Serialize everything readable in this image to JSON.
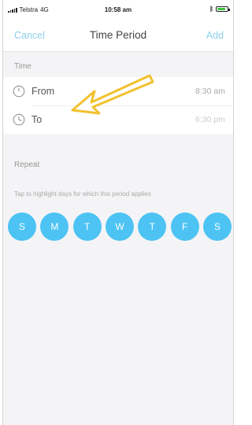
{
  "status_bar": {
    "carrier": "Telstra",
    "network": "4G",
    "time": "10:58 am",
    "bluetooth": "bluetooth-icon",
    "battery": "battery-icon",
    "battery_level": 0.8
  },
  "nav": {
    "cancel_label": "Cancel",
    "title": "Time Period",
    "add_label": "Add",
    "accent_color": "#8fd0ea"
  },
  "time_section": {
    "label": "Time",
    "from": {
      "label": "From",
      "value": "8:30 am",
      "icon": "clock-icon"
    },
    "to": {
      "label": "To",
      "value": "6:30 pm",
      "icon": "clock-icon"
    }
  },
  "repeat_section": {
    "label": "Repeat",
    "hint": "Tap to highlight days for which this period applies",
    "days": [
      "S",
      "M",
      "T",
      "W",
      "T",
      "F",
      "S"
    ],
    "day_color": "#4cc3f3"
  },
  "annotation": {
    "arrow_color": "#f2c12e",
    "icon": "arrow-annotation-icon"
  }
}
